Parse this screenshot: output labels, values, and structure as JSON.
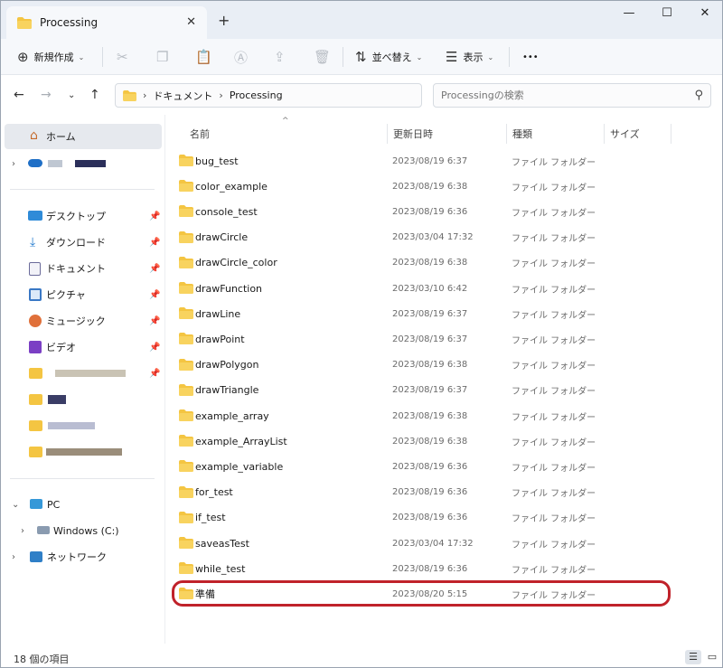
{
  "window": {
    "tab_title": "Processing",
    "new_tab_symbol": "+",
    "close_tab_symbol": "✕",
    "minimize_symbol": "—",
    "maximize_symbol": "☐",
    "close_symbol": "✕"
  },
  "toolbar": {
    "new_label": "新規作成",
    "sort_label": "並べ替え",
    "view_label": "表示",
    "more_label": "•••"
  },
  "address": {
    "crumbs": [
      "ドキュメント",
      "Processing"
    ],
    "search_placeholder": "Processingの検索"
  },
  "sidebar": {
    "home": "ホーム",
    "quick": [
      "デスクトップ",
      "ダウンロード",
      "ドキュメント",
      "ピクチャ",
      "ミュージック",
      "ビデオ"
    ],
    "pc": "PC",
    "drive": "Windows (C:)",
    "network": "ネットワーク"
  },
  "columns": {
    "name": "名前",
    "date": "更新日時",
    "type": "種類",
    "size": "サイズ"
  },
  "files": [
    {
      "name": "bug_test",
      "date": "2023/08/19 6:37",
      "type": "ファイル フォルダー"
    },
    {
      "name": "color_example",
      "date": "2023/08/19 6:38",
      "type": "ファイル フォルダー"
    },
    {
      "name": "console_test",
      "date": "2023/08/19 6:36",
      "type": "ファイル フォルダー"
    },
    {
      "name": "drawCircle",
      "date": "2023/03/04 17:32",
      "type": "ファイル フォルダー"
    },
    {
      "name": "drawCircle_color",
      "date": "2023/08/19 6:38",
      "type": "ファイル フォルダー"
    },
    {
      "name": "drawFunction",
      "date": "2023/03/10 6:42",
      "type": "ファイル フォルダー"
    },
    {
      "name": "drawLine",
      "date": "2023/08/19 6:37",
      "type": "ファイル フォルダー"
    },
    {
      "name": "drawPoint",
      "date": "2023/08/19 6:37",
      "type": "ファイル フォルダー"
    },
    {
      "name": "drawPolygon",
      "date": "2023/08/19 6:38",
      "type": "ファイル フォルダー"
    },
    {
      "name": "drawTriangle",
      "date": "2023/08/19 6:37",
      "type": "ファイル フォルダー"
    },
    {
      "name": "example_array",
      "date": "2023/08/19 6:38",
      "type": "ファイル フォルダー"
    },
    {
      "name": "example_ArrayList",
      "date": "2023/08/19 6:38",
      "type": "ファイル フォルダー"
    },
    {
      "name": "example_variable",
      "date": "2023/08/19 6:36",
      "type": "ファイル フォルダー"
    },
    {
      "name": "for_test",
      "date": "2023/08/19 6:36",
      "type": "ファイル フォルダー"
    },
    {
      "name": "if_test",
      "date": "2023/08/19 6:36",
      "type": "ファイル フォルダー"
    },
    {
      "name": "saveasTest",
      "date": "2023/03/04 17:32",
      "type": "ファイル フォルダー"
    },
    {
      "name": "while_test",
      "date": "2023/08/19 6:36",
      "type": "ファイル フォルダー"
    },
    {
      "name": "準備",
      "date": "2023/08/20 5:15",
      "type": "ファイル フォルダー"
    }
  ],
  "status": {
    "item_count": "18 個の項目"
  },
  "colors": {
    "folder": "#f4c542",
    "highlight": "#c0222a",
    "accent": "#0067c0"
  }
}
